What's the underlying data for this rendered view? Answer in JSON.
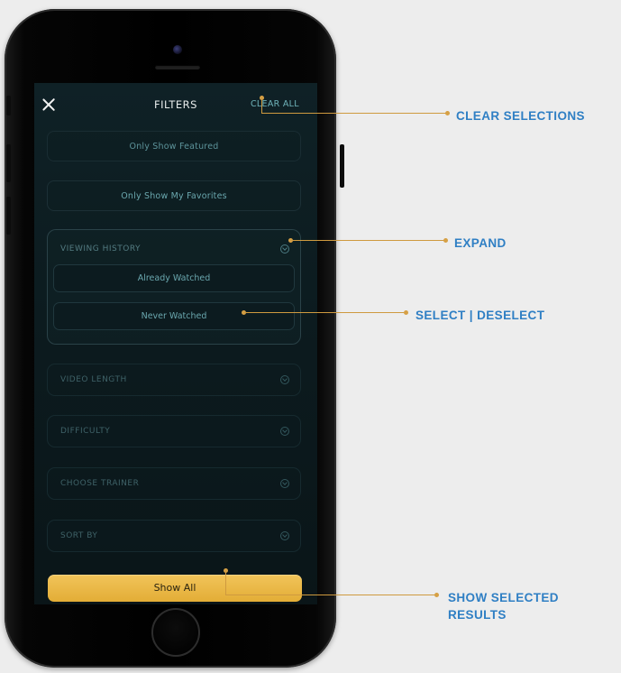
{
  "header": {
    "title": "FILTERS",
    "clear_all": "CLEAR ALL"
  },
  "toggles": {
    "featured": "Only Show Featured",
    "favorites": "Only Show My Favorites"
  },
  "viewing_history": {
    "label": "VIEWING HISTORY",
    "options": [
      "Already Watched",
      "Never Watched"
    ]
  },
  "sections": [
    "VIDEO LENGTH",
    "DIFFICULTY",
    "CHOOSE TRAINER",
    "SORT BY"
  ],
  "show_all": "Show All",
  "callouts": {
    "clear": "CLEAR SELECTIONS",
    "expand": "EXPAND",
    "select": "SELECT | DESELECT",
    "show_line1": "SHOW SELECTED",
    "show_line2": "RESULTS"
  },
  "colors": {
    "accent_gold": "#e8b443",
    "callout_text": "#2f7fc4",
    "screen_bg": "#0d1d21"
  }
}
